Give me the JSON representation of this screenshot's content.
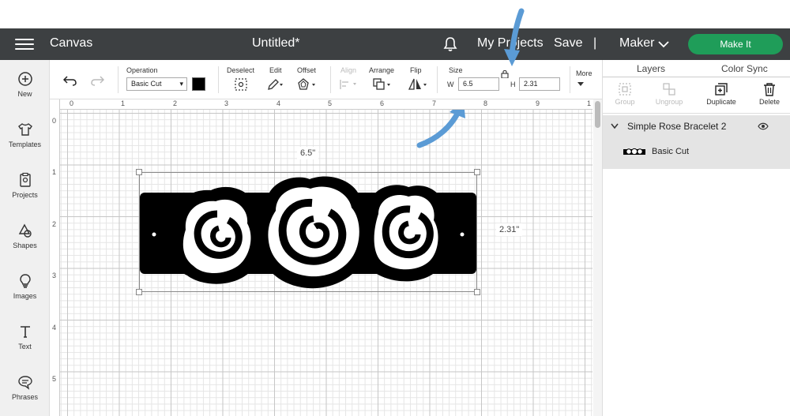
{
  "app": {
    "title": "Canvas",
    "document_title": "Untitled*",
    "my_projects": "My Projects",
    "save": "Save",
    "divider": "|",
    "machine": "Maker",
    "make_it": "Make It"
  },
  "left_nav": [
    {
      "label": "New",
      "icon": "plus-circle-icon"
    },
    {
      "label": "Templates",
      "icon": "shirt-icon"
    },
    {
      "label": "Projects",
      "icon": "clipboard-icon"
    },
    {
      "label": "Shapes",
      "icon": "shapes-icon"
    },
    {
      "label": "Images",
      "icon": "lightbulb-icon"
    },
    {
      "label": "Text",
      "icon": "text-icon"
    },
    {
      "label": "Phrases",
      "icon": "speech-bubble-icon"
    }
  ],
  "toolbar": {
    "operation_label": "Operation",
    "operation_value": "Basic Cut",
    "deselect": "Deselect",
    "edit": "Edit",
    "offset": "Offset",
    "align": "Align",
    "arrange": "Arrange",
    "flip": "Flip",
    "size_label": "Size",
    "w_label": "W",
    "w_value": "6.5",
    "h_label": "H",
    "h_value": "2.31",
    "more": "More",
    "swatch_color": "#000000"
  },
  "ruler": {
    "top": [
      "0",
      "1",
      "2",
      "3",
      "4",
      "5",
      "6",
      "7",
      "8",
      "9",
      "1"
    ],
    "left": [
      "0",
      "1",
      "2",
      "3",
      "4",
      "5"
    ]
  },
  "canvas": {
    "width_label": "6.5\"",
    "height_label": "2.31\""
  },
  "layers_panel": {
    "tab_layers": "Layers",
    "tab_color_sync": "Color Sync",
    "tools": [
      {
        "label": "Group",
        "enabled": false
      },
      {
        "label": "Ungroup",
        "enabled": false
      },
      {
        "label": "Duplicate",
        "enabled": true
      },
      {
        "label": "Delete",
        "enabled": true
      }
    ],
    "group_name": "Simple Rose Bracelet 2",
    "layer_name": "Basic Cut"
  },
  "colors": {
    "topbar": "#3d4042",
    "make_it": "#1f9d59",
    "annotation_arrow": "#5b9bd5"
  }
}
